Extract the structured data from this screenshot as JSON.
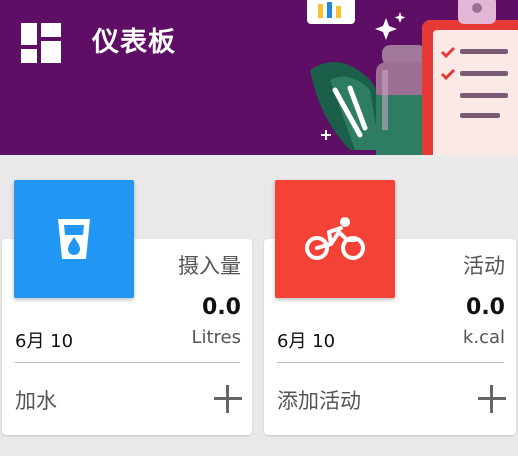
{
  "header": {
    "title": "仪表板",
    "menu_icon": "dashboard-grid-icon",
    "background": "#5e0e64"
  },
  "cards": [
    {
      "icon": "water-glass-icon",
      "tile_color": "#2196f3",
      "label": "摄入量",
      "value": "0.0",
      "date": "6月 10",
      "unit": "Litres",
      "action": "加水",
      "action_icon": "plus-icon"
    },
    {
      "icon": "bicycle-icon",
      "tile_color": "#f44336",
      "label": "活动",
      "value": "0.0",
      "date": "6月 10",
      "unit": "k.cal",
      "action": "添加活动",
      "action_icon": "plus-icon"
    }
  ]
}
